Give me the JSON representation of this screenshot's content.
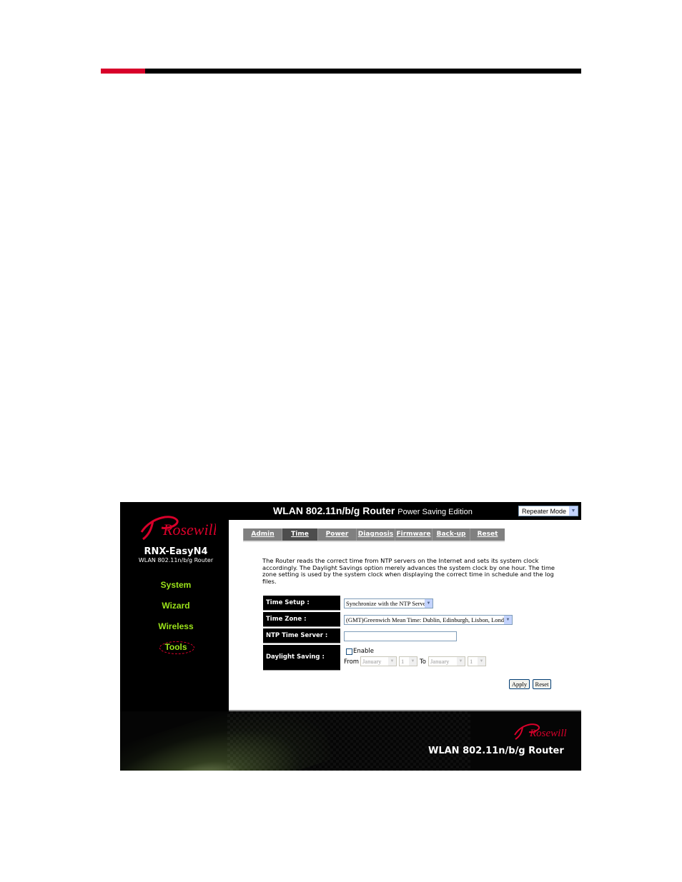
{
  "page": {
    "rule_colors": {
      "accent": "#d8002a",
      "bar": "#000000"
    }
  },
  "app": {
    "brand": "Rosewill",
    "model": "RNX-EasyN4",
    "model_subtitle": "WLAN 802.11n/b/g Router",
    "title": "WLAN 802.11n/b/g Router",
    "title_suffix": "Power Saving Edition",
    "mode_select": {
      "value": "Repeater Mode"
    }
  },
  "sidebar": {
    "items": [
      {
        "label": "System",
        "active": false
      },
      {
        "label": "Wizard",
        "active": false
      },
      {
        "label": "Wireless",
        "active": false
      },
      {
        "label": "Tools",
        "active": true
      }
    ],
    "color": "#9be21a"
  },
  "tabs": [
    {
      "label": "Admin",
      "active": false
    },
    {
      "label": "Time",
      "active": true
    },
    {
      "label": "Power",
      "active": false
    },
    {
      "label": "Diagnosis",
      "active": false
    },
    {
      "label": "Firmware",
      "active": false
    },
    {
      "label": "Back-up",
      "active": false
    },
    {
      "label": "Reset",
      "active": false
    }
  ],
  "description": "The Router reads the correct time from NTP servers on the Internet and sets its system clock accordingly. The Daylight Savings option merely advances the system clock by one hour. The time zone setting is used by the system clock when displaying the correct time in schedule and the log files.",
  "form": {
    "time_setup": {
      "label": "Time Setup :",
      "value": "Synchronize with the NTP Server"
    },
    "time_zone": {
      "label": "Time Zone :",
      "value": "(GMT)Greenwich Mean Time: Dublin, Edinburgh, Lisbon, London"
    },
    "ntp_server": {
      "label": "NTP Time Server :",
      "value": ""
    },
    "daylight": {
      "label": "Daylight Saving :",
      "enable_label": "Enable",
      "enabled": false,
      "from_label": "From",
      "to_label": "To",
      "from_month": "January",
      "from_day": "1",
      "to_month": "January",
      "to_day": "1"
    }
  },
  "buttons": {
    "apply": "Apply",
    "reset": "Reset"
  },
  "footer": {
    "brand": "Rosewill",
    "title": "WLAN 802.11n/b/g Router"
  }
}
